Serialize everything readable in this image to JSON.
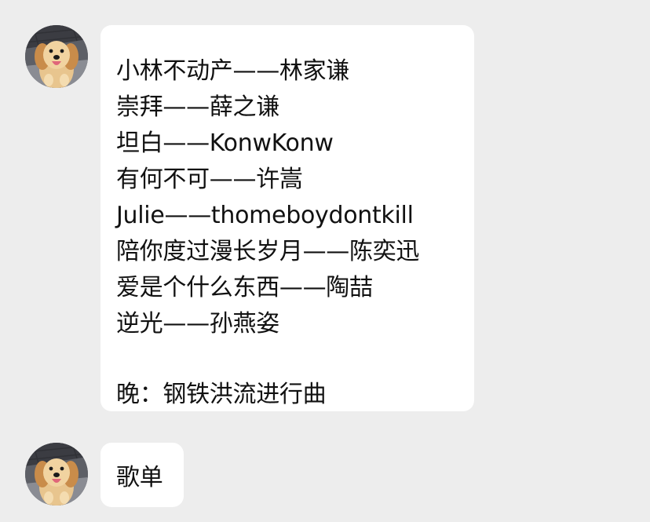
{
  "conversation": {
    "messages": [
      {
        "sender_avatar": "golden-retriever-puppy",
        "lines": [
          "小林不动产——林家谦",
          "崇拜——薛之谦",
          "坦白——KonwKonw",
          "有何不可——许嵩",
          "Julie——thomeboydontkill",
          "陪你度过漫长岁月——陈奕迅",
          "爱是个什么东西——陶喆",
          "逆光——孙燕姿"
        ],
        "footer": "晚：钢铁洪流进行曲"
      },
      {
        "sender_avatar": "golden-retriever-puppy",
        "text": "歌单"
      }
    ]
  },
  "colors": {
    "background": "#ededed",
    "bubble": "#ffffff",
    "text": "#111111"
  }
}
